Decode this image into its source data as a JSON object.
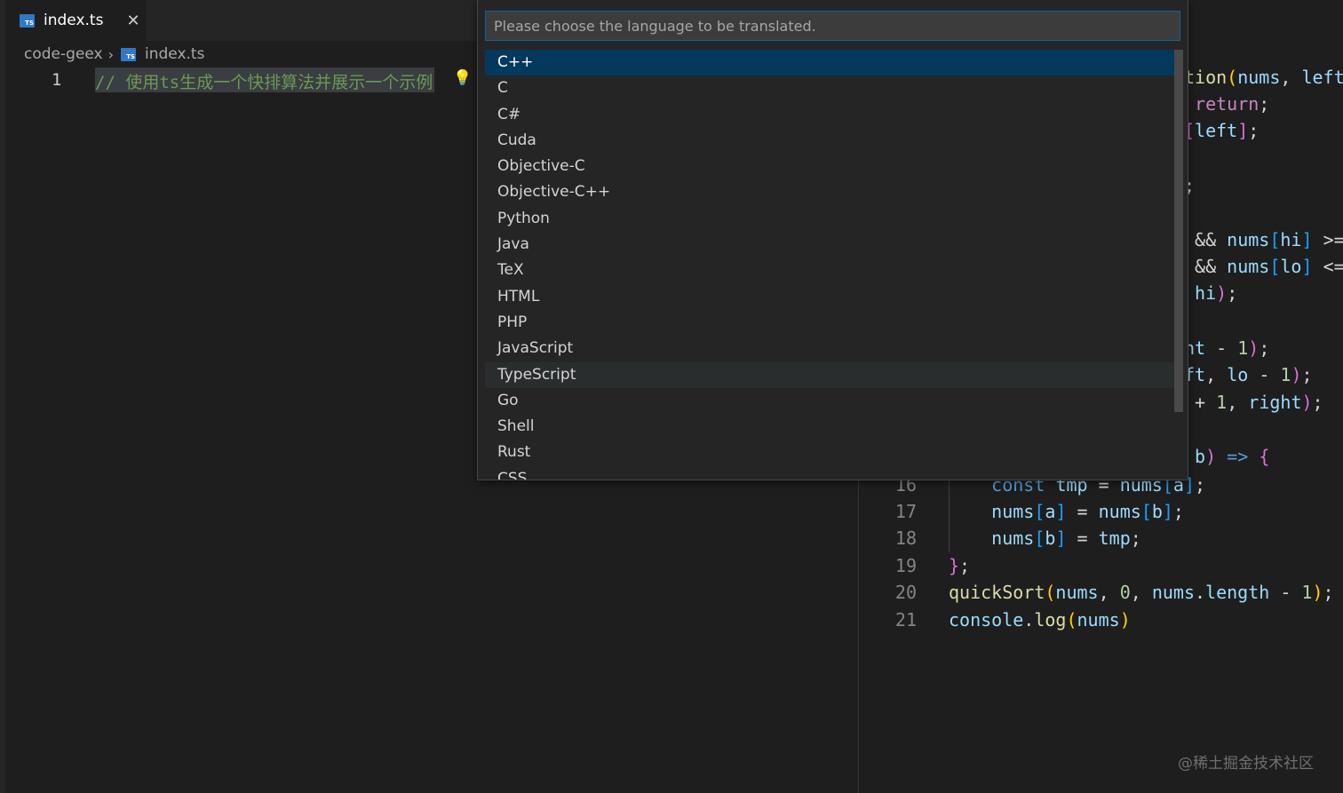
{
  "tab": {
    "label": "index.ts",
    "icon": "ts-file-icon",
    "icon_text": "TS",
    "close": "✕"
  },
  "breadcrumb": {
    "folder": "code-geex",
    "separator": "›",
    "file": "index.ts"
  },
  "editor_left": {
    "line_number": "1",
    "comment": "// 使用ts生成一个快排算法并展示一个示例",
    "bulb": "💡"
  },
  "quick_pick": {
    "placeholder": "Please choose the language to be translated.",
    "items": [
      "C++",
      "C",
      "C#",
      "Cuda",
      "Objective-C",
      "Objective-C++",
      "Python",
      "Java",
      "TeX",
      "HTML",
      "PHP",
      "JavaScript",
      "TypeScript",
      "Go",
      "Shell",
      "Rust",
      "CSS"
    ],
    "selected": "C++",
    "hovered": "TypeScript"
  },
  "editor_right": {
    "partial_lines": [
      "tion(nums, left",
      " return;",
      "[left];",
      ";",
      " && nums[hi] >=",
      " && nums[lo] <=",
      " hi);",
      "nt - 1);",
      "ft, lo - 1);",
      " + 1, right);",
      " b) => {"
    ],
    "full_lines": [
      {
        "num": "16",
        "code": "    const tmp = nums[a];"
      },
      {
        "num": "17",
        "code": "    nums[a] = nums[b];"
      },
      {
        "num": "18",
        "code": "    nums[b] = tmp;"
      },
      {
        "num": "19",
        "code": "};"
      },
      {
        "num": "20",
        "code": "quickSort(nums, 0, nums.length - 1);"
      },
      {
        "num": "21",
        "code": "console.log(nums)"
      }
    ]
  },
  "watermark": "@稀土掘金技术社区"
}
